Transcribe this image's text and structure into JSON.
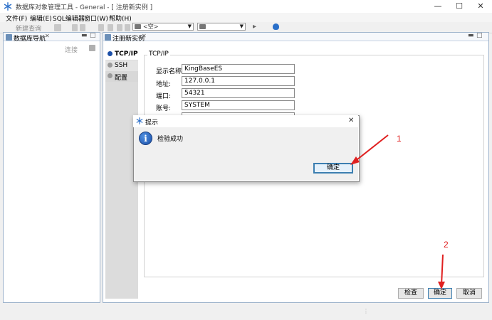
{
  "window": {
    "title": "数据库对象管理工具 - General - [ 注册新实例 ]",
    "minimize": "—",
    "maximize": "☐",
    "close": "✕"
  },
  "menu": [
    "文件(F)",
    "编辑(E)",
    "SQL编辑器",
    "窗口(W)",
    "帮助(H)"
  ],
  "toolbar": {
    "new_query": "新建查询",
    "combo1": "<空>",
    "combo2": ""
  },
  "navigator": {
    "tab_label": "数据库导航",
    "connect_label": "连接"
  },
  "editor": {
    "tab_label": "注册新实例",
    "side_tabs": [
      "TCP/IP",
      "SSH",
      "配置"
    ],
    "section_title": "TCP/IP",
    "fields": [
      {
        "label": "显示名称:",
        "value": "KingBaseES"
      },
      {
        "label": "地址:",
        "value": "127.0.0.1"
      },
      {
        "label": "端口:",
        "value": "54321"
      },
      {
        "label": "账号:",
        "value": "SYSTEM"
      }
    ],
    "buttons": {
      "check": "检查",
      "ok": "确定",
      "cancel": "取消"
    }
  },
  "dialog": {
    "title": "提示",
    "message": "检验成功",
    "ok": "确定",
    "close": "✕"
  },
  "annotations": {
    "one": "1",
    "two": "2"
  },
  "colors": {
    "accent": "#1b4fa8",
    "annotation": "#e02020",
    "focus_border": "#3c7fb1"
  }
}
